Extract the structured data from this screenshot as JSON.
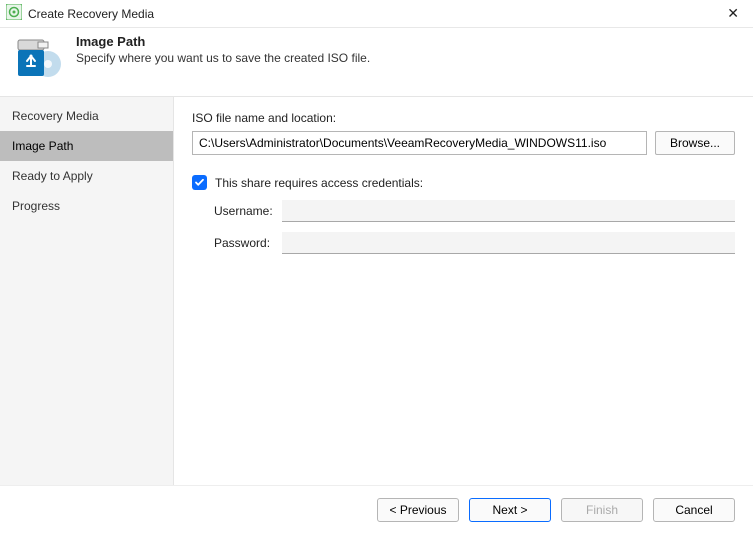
{
  "window": {
    "title": "Create Recovery Media"
  },
  "header": {
    "title": "Image Path",
    "subtitle": "Specify where you want us to save the created ISO file."
  },
  "sidebar": {
    "items": [
      {
        "label": "Recovery Media"
      },
      {
        "label": "Image Path"
      },
      {
        "label": "Ready to Apply"
      },
      {
        "label": "Progress"
      }
    ]
  },
  "main": {
    "path_label": "ISO file name and location:",
    "path_value": "C:\\Users\\Administrator\\Documents\\VeeamRecoveryMedia_WINDOWS11.iso",
    "browse_label": "Browse...",
    "cred_checkbox_label": "This share requires access credentials:",
    "username_label": "Username:",
    "username_value": "",
    "password_label": "Password:",
    "password_value": ""
  },
  "footer": {
    "previous": "< Previous",
    "next": "Next >",
    "finish": "Finish",
    "cancel": "Cancel"
  }
}
